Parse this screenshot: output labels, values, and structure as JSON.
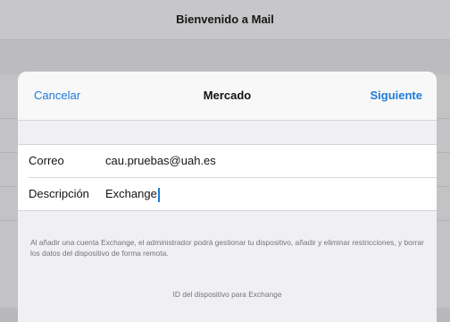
{
  "background": {
    "title": "Bienvenido a Mail"
  },
  "sheet": {
    "nav": {
      "cancel_label": "Cancelar",
      "title": "Mercado",
      "next_label": "Siguiente"
    },
    "fields": [
      {
        "label": "Correo",
        "value": "cau.pruebas@uah.es"
      },
      {
        "label": "Descripción",
        "value": "Exchange"
      }
    ],
    "footnote": "Al añadir una cuenta Exchange, el administrador podrá gestionar tu dispositivo, añadir y eliminar restricciones, y borrar los datos del dispositivo de forma remota.",
    "device_id_label": "ID del dispositivo para Exchange"
  },
  "colors": {
    "accent": "#1e7bd8",
    "sheet_background": "#efeff4",
    "dimmed_background": "#c3c3c6"
  }
}
